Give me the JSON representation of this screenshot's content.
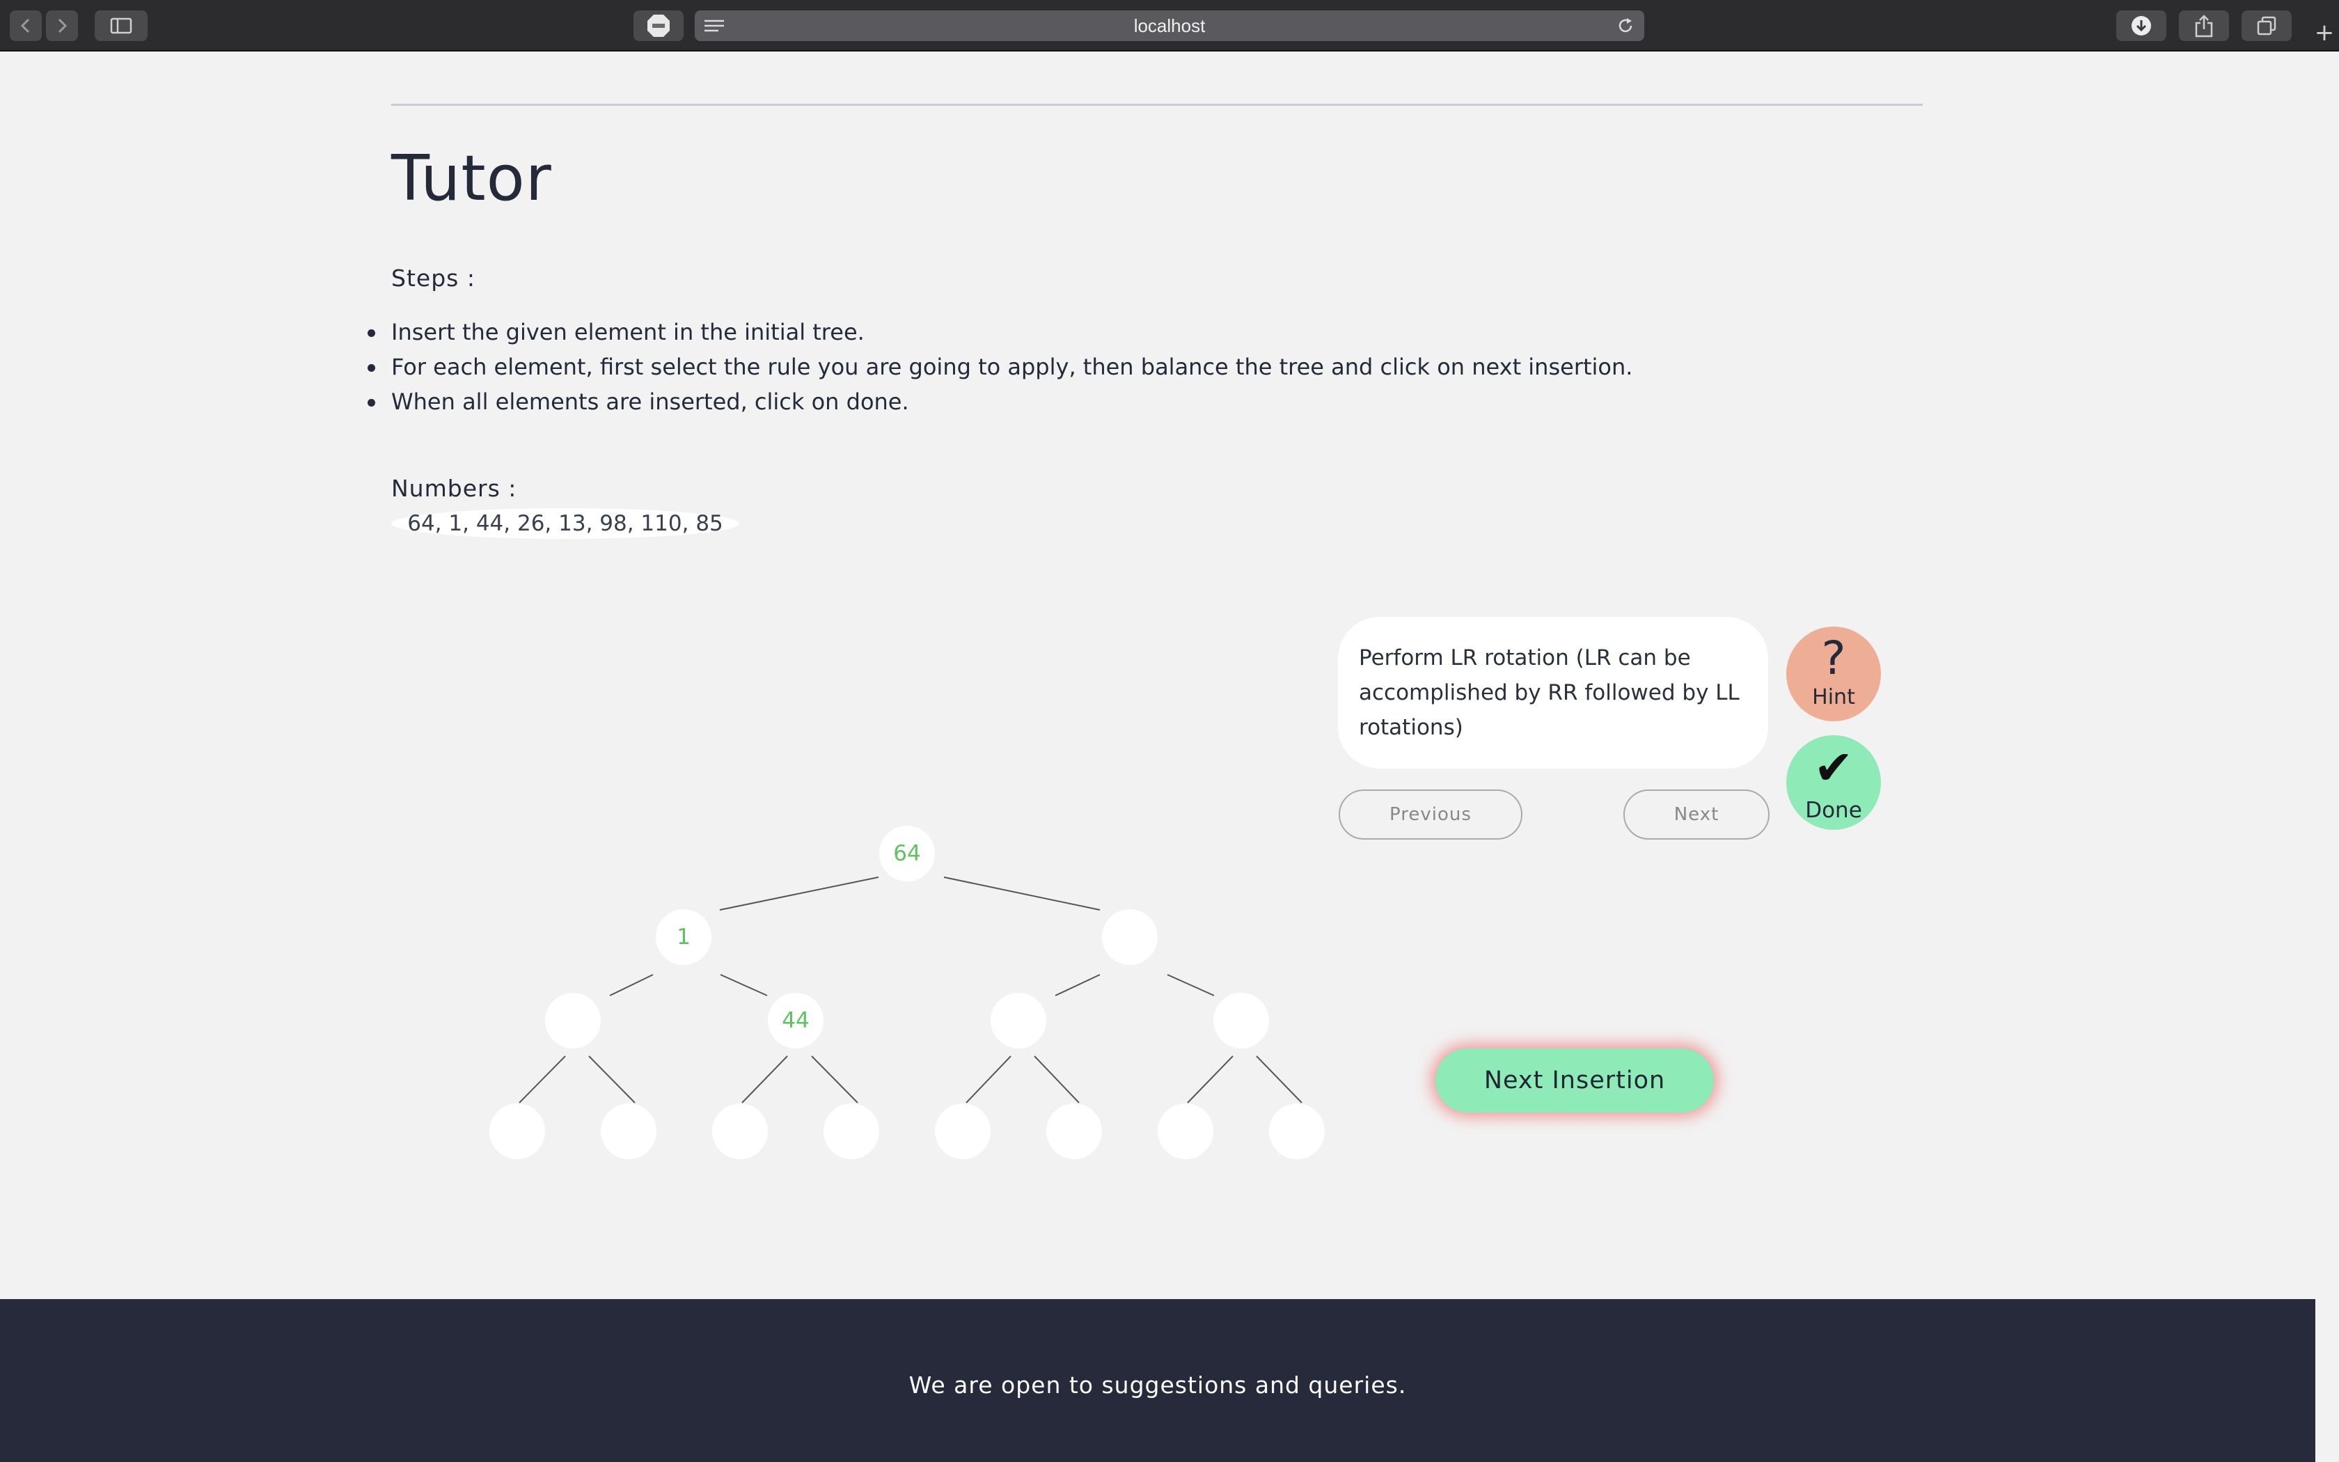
{
  "browser": {
    "url": "localhost",
    "new_tab_symbol": "+"
  },
  "page": {
    "title": "Tutor",
    "steps_heading": "Steps :",
    "steps": [
      "Insert the given element in the initial tree.",
      "For each element, first select the rule you are going to apply, then balance the tree and click on next insertion.",
      "When all elements are inserted, click on done."
    ],
    "numbers_heading": "Numbers :",
    "numbers": "64, 1, 44, 26, 13, 98, 110, 85"
  },
  "tree": {
    "root": "64",
    "level1": [
      "1",
      ""
    ],
    "level2": [
      "",
      "44",
      "",
      ""
    ],
    "level3": [
      "",
      "",
      "",
      "",
      "",
      "",
      "",
      ""
    ]
  },
  "hint_panel": {
    "message": "Perform LR rotation (LR can be accomplished by RR followed by LL rotations)",
    "hint_symbol": "?",
    "hint_label": "Hint",
    "done_symbol": "✔",
    "done_label": "Done",
    "previous_label": "Previous",
    "next_label": "Next"
  },
  "next_insertion_label": "Next Insertion",
  "footer": {
    "text": "We are open to suggestions and queries."
  },
  "colors": {
    "node_text": "#5ec25e",
    "hint_circle": "#eeae95",
    "done_circle": "#8eeab6",
    "footer_bg": "#262a3a"
  }
}
